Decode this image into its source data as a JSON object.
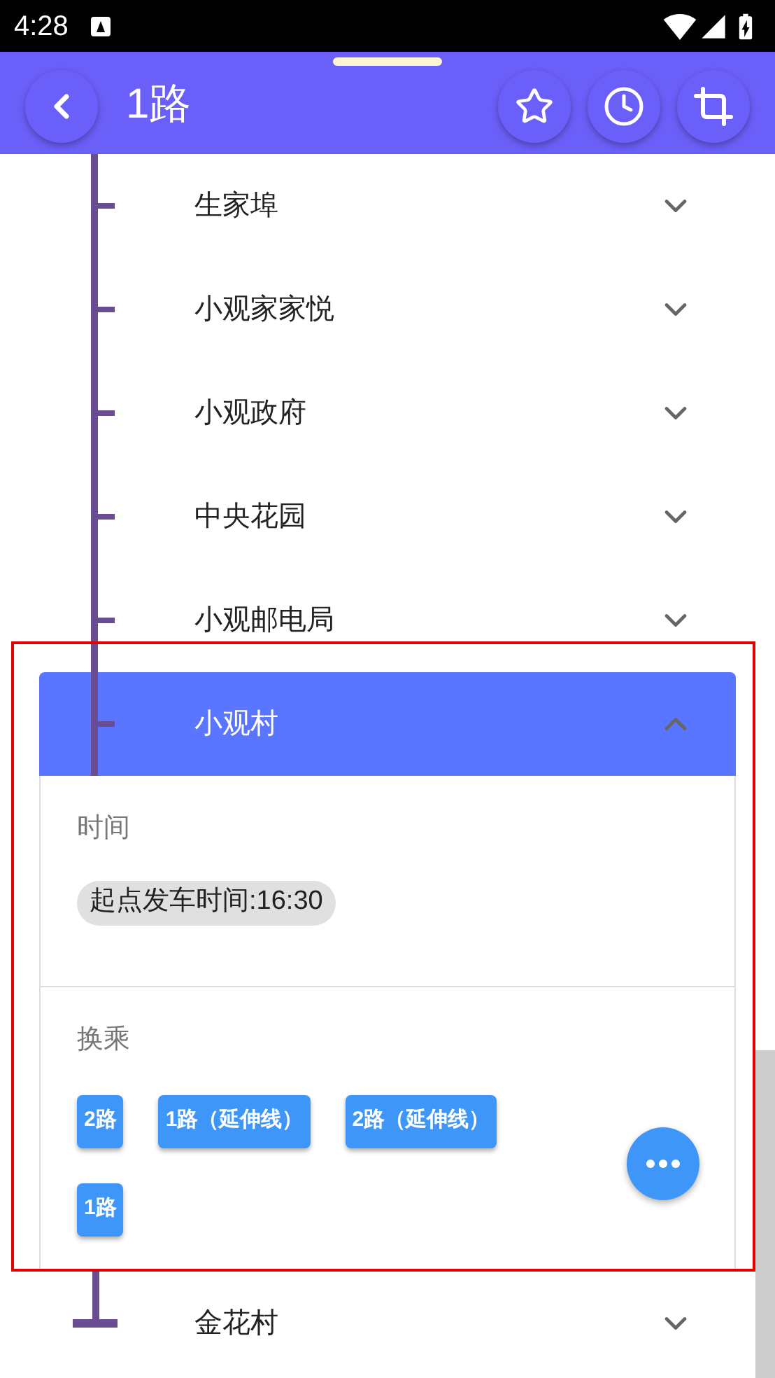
{
  "status_bar": {
    "time": "4:28"
  },
  "app_bar": {
    "title": "1路"
  },
  "stations": [
    {
      "name": "生家埠",
      "kind": "stop",
      "expanded": false
    },
    {
      "name": "小观家家悦",
      "kind": "stop",
      "expanded": false
    },
    {
      "name": "小观政府",
      "kind": "stop",
      "expanded": false
    },
    {
      "name": "中央花园",
      "kind": "stop",
      "expanded": false
    },
    {
      "name": "小观邮电局",
      "kind": "stop",
      "expanded": false
    },
    {
      "name": "小观村",
      "kind": "stop",
      "expanded": true,
      "highlighted": true,
      "details": {
        "time_label": "时间",
        "departure": "起点发车时间:16:30",
        "transfer_label": "换乘",
        "transfers": [
          "2路",
          "1路（延伸线）",
          "2路（延伸线）",
          "1路"
        ]
      }
    },
    {
      "name": "金花村",
      "kind": "terminal",
      "expanded": false
    }
  ]
}
